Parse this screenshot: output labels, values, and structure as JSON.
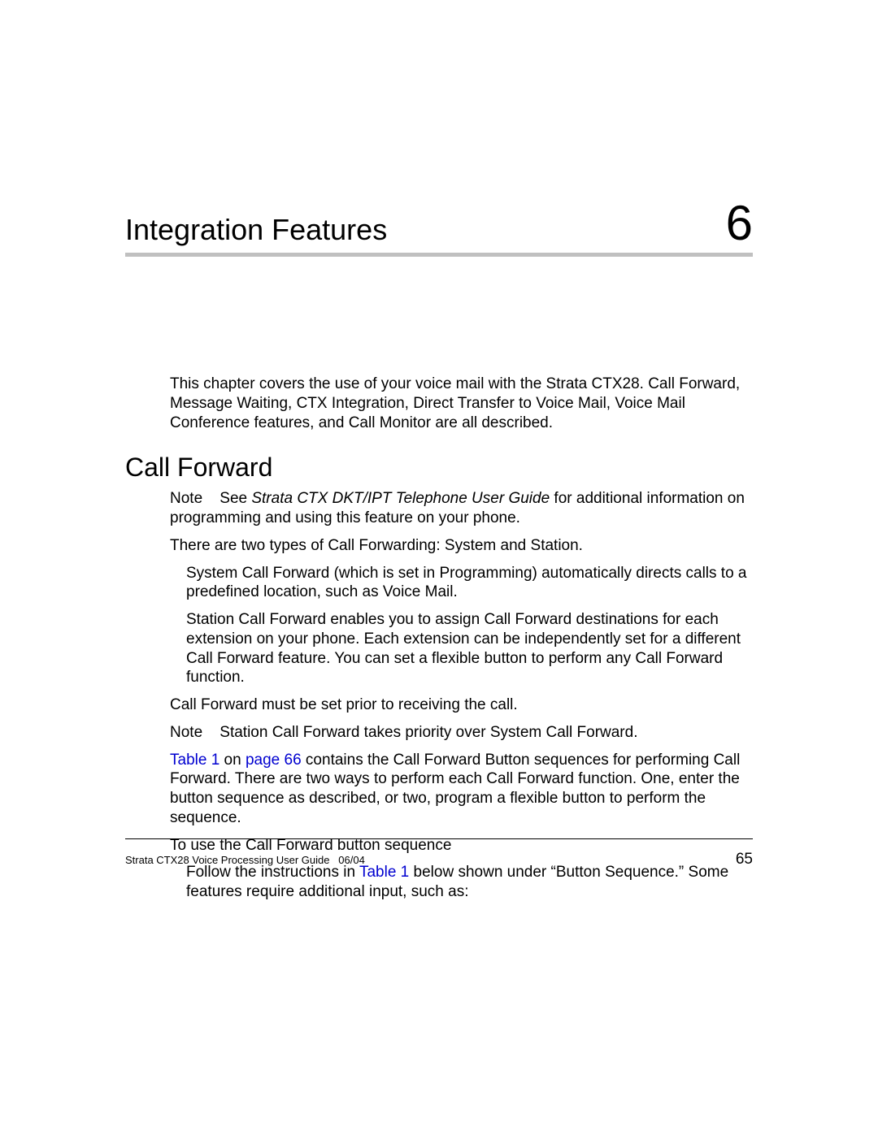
{
  "chapter": {
    "title": "Integration Features",
    "number": "6"
  },
  "intro": "This chapter covers the use of your voice mail with the Strata CTX28. Call Forward, Message Waiting, CTX Integration, Direct Transfer to Voice Mail, Voice Mail Conference features, and Call Monitor are all described.",
  "section1": {
    "heading": "Call Forward",
    "note1_label": "Note",
    "note1_pre": "See ",
    "note1_italic": "Strata CTX DKT/IPT Telephone User Guide",
    "note1_post": " for additional information on programming and using this feature on your phone.",
    "para1": "There are two types of Call Forwarding: System and Station.",
    "bullet1": "System Call Forward (which is set in Programming) automatically directs calls to a predefined location, such as Voice Mail.",
    "bullet2": "Station Call Forward enables you to assign Call Forward destinations for each extension on your phone. Each extension can be independently set for a different Call Forward feature. You can set a flexible button to perform any Call Forward function.",
    "para2": "Call Forward must be set prior to receiving the call.",
    "note2_label": "Note",
    "note2_text": "Station Call Forward takes priority over System Call Forward.",
    "para3_link1": "Table 1 ",
    "para3_mid": "on ",
    "para3_link2": "page 66",
    "para3_rest": " contains the Call Forward Button sequences for performing Call Forward. There are two ways to perform each Call Forward function. One, enter the button sequence as described, or two, program a flexible button to perform the sequence.",
    "para4": "To use the Call Forward button sequence",
    "bullet3_pre": "Follow the instructions in ",
    "bullet3_link": "Table 1",
    "bullet3_post": " below shown under “Button Sequence.” Some features require additional input, such as:"
  },
  "footer": {
    "left": "Strata CTX28 Voice Processing User Guide   06/04",
    "right": "65"
  }
}
